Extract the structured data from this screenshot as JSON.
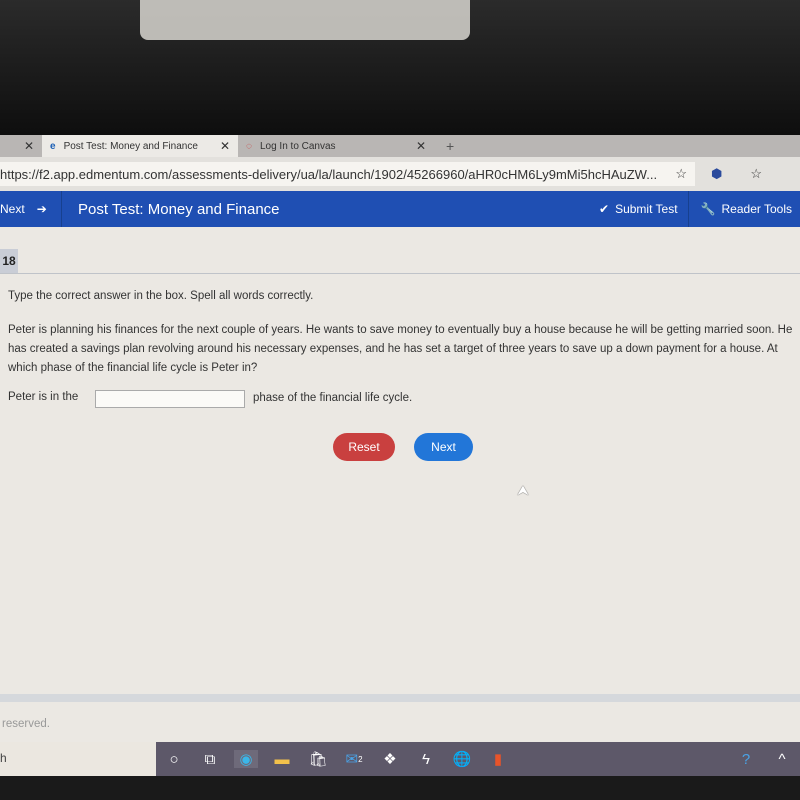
{
  "browser": {
    "tabs": [
      {
        "label": "Post Test: Money and Finance",
        "icon": "edge-e-icon"
      },
      {
        "label": "Log In to Canvas",
        "icon": "canvas-icon"
      }
    ],
    "url": "https://f2.app.edmentum.com/assessments-delivery/ua/la/launch/1902/45266960/aHR0cHM6Ly9mMi5hcHAuZW..."
  },
  "header": {
    "next_label": "Next",
    "title": "Post Test: Money and Finance",
    "submit_label": "Submit Test",
    "reader_tools_label": "Reader Tools",
    "color": "#1f4fb3"
  },
  "question": {
    "number": "18",
    "instruction": "Type the correct answer in the box. Spell all words correctly.",
    "prompt": "Peter is planning his finances for the next couple of years. He wants to save money to eventually buy a house because he will be getting married soon. He has created a savings plan revolving around his necessary expenses, and he has set a target of three years to save up a down payment for a house. At which phase of the financial life cycle is Peter in?",
    "answer_prefix": "Peter is in the",
    "answer_value": "",
    "answer_suffix": "phase of the financial life cycle."
  },
  "buttons": {
    "reset": "Reset",
    "next": "Next",
    "reset_color": "#c9403f",
    "next_color": "#2276d8"
  },
  "footer": {
    "text": "reserved."
  },
  "taskbar": {
    "search_fragment": "h",
    "mail_badge": "2"
  }
}
